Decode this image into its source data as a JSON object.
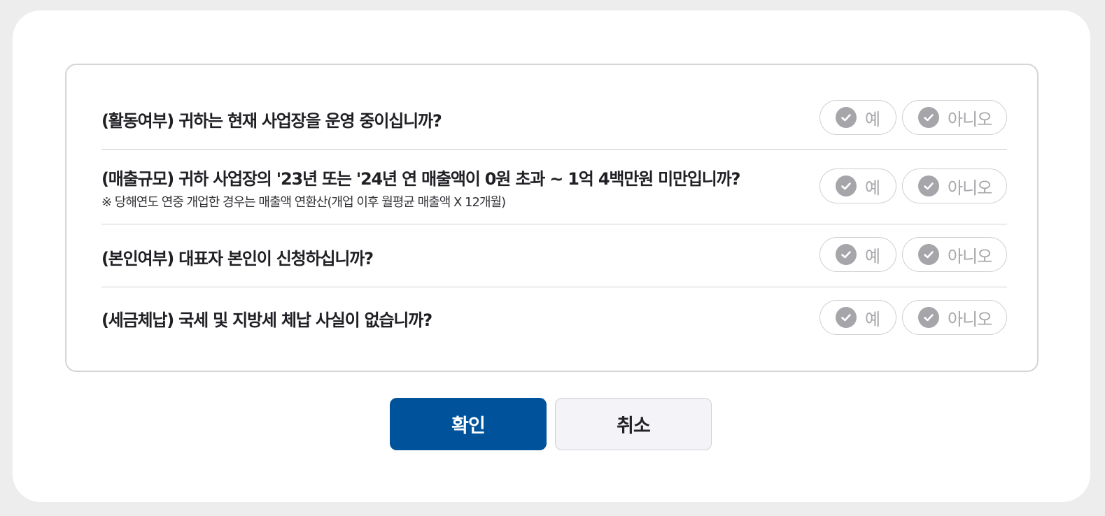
{
  "questions": [
    {
      "text": "(활동여부) 귀하는 현재 사업장을 운영 중이십니까?",
      "note": "",
      "yes_label": "예",
      "no_label": "아니오"
    },
    {
      "text": "(매출규모) 귀하 사업장의 '23년 또는 '24년 연 매출액이 0원 초과 ~ 1억 4백만원 미만입니까?",
      "note": "※ 당해연도 연중 개업한 경우는 매출액 연환산(개업 이후 월평균 매출액 X 12개월)",
      "yes_label": "예",
      "no_label": "아니오"
    },
    {
      "text": "(본인여부) 대표자 본인이 신청하십니까?",
      "note": "",
      "yes_label": "예",
      "no_label": "아니오"
    },
    {
      "text": "(세금체납) 국세 및 지방세 체납 사실이 없습니까?",
      "note": "",
      "yes_label": "예",
      "no_label": "아니오"
    }
  ],
  "buttons": {
    "confirm_label": "확인",
    "cancel_label": "취소"
  },
  "colors": {
    "primary": "#00529b",
    "unselected_option": "#a6a6aa",
    "page_background": "#ededed"
  },
  "icons": {
    "option_check": "check-circle-icon"
  }
}
